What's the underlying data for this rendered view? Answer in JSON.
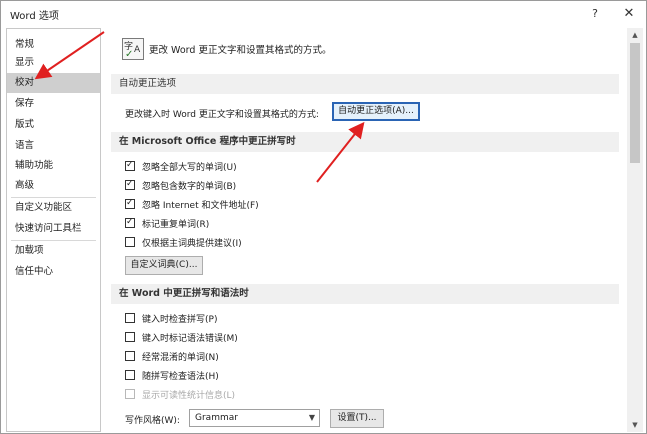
{
  "window": {
    "title": "Word 选项",
    "help_label": "?",
    "close_label": "✕"
  },
  "sidebar": {
    "items": [
      {
        "label": "常规"
      },
      {
        "label": "显示"
      },
      {
        "label": "校对",
        "selected": true
      },
      {
        "label": "保存"
      },
      {
        "label": "版式"
      },
      {
        "label": "语言"
      },
      {
        "label": "辅助功能"
      },
      {
        "label": "高级"
      },
      {
        "label": "自定义功能区"
      },
      {
        "label": "快速访问工具栏"
      },
      {
        "label": "加载项"
      },
      {
        "label": "信任中心"
      }
    ]
  },
  "main": {
    "header_text": "更改 Word 更正文字和设置其格式的方式。",
    "header_icon": "proofing-abc-check-icon",
    "autocorrect": {
      "section_title": "自动更正选项",
      "description": "更改键入时 Word 更正文字和设置其格式的方式:",
      "button_label": "自动更正选项(A)..."
    },
    "office_spelling": {
      "section_title": "在 Microsoft Office 程序中更正拼写时",
      "options": [
        {
          "label": "忽略全部大写的单词(U)",
          "checked": true
        },
        {
          "label": "忽略包含数字的单词(B)",
          "checked": true
        },
        {
          "label": "忽略 Internet 和文件地址(F)",
          "checked": true
        },
        {
          "label": "标记重复单词(R)",
          "checked": true
        },
        {
          "label": "仅根据主词典提供建议(I)",
          "checked": false
        }
      ],
      "custom_dict_button": "自定义词典(C)..."
    },
    "word_spelling": {
      "section_title": "在 Word 中更正拼写和语法时",
      "options": [
        {
          "label": "键入时检查拼写(P)",
          "checked": false,
          "disabled": false
        },
        {
          "label": "键入时标记语法错误(M)",
          "checked": false,
          "disabled": false
        },
        {
          "label": "经常混淆的单词(N)",
          "checked": false,
          "disabled": false
        },
        {
          "label": "随拼写检查语法(H)",
          "checked": false,
          "disabled": false
        },
        {
          "label": "显示可读性统计信息(L)",
          "checked": false,
          "disabled": true
        }
      ],
      "writing_style_label": "写作风格(W):",
      "writing_style_value": "Grammar",
      "settings_button": "设置(T)..."
    }
  },
  "annotations": {
    "arrow_color": "#e02020"
  },
  "colors": {
    "selected_nav_bg": "#cfcfcf",
    "section_header_bg": "#f0f0f0",
    "focus_border": "#2a64b4"
  }
}
